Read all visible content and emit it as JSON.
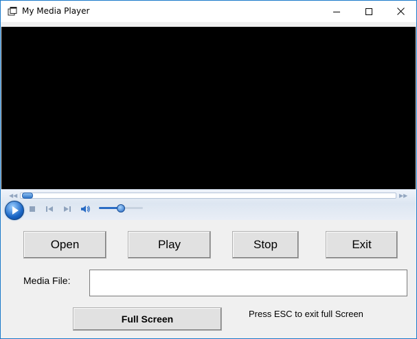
{
  "window": {
    "title": "My Media Player",
    "controls": {
      "minimize": "minimize-icon",
      "maximize": "maximize-icon",
      "close": "close-icon"
    }
  },
  "player": {
    "video_color": "#000000",
    "seek_position": 0.01,
    "volume_level": 0.5,
    "icons": [
      "play-icon",
      "stop-icon",
      "previous-icon",
      "next-icon",
      "speaker-icon"
    ]
  },
  "buttons": {
    "open": "Open",
    "play": "Play",
    "stop": "Stop",
    "exit": "Exit",
    "full_screen": "Full Screen"
  },
  "media_file": {
    "label": "Media File:",
    "value": ""
  },
  "hint": "Press ESC to exit full Screen"
}
